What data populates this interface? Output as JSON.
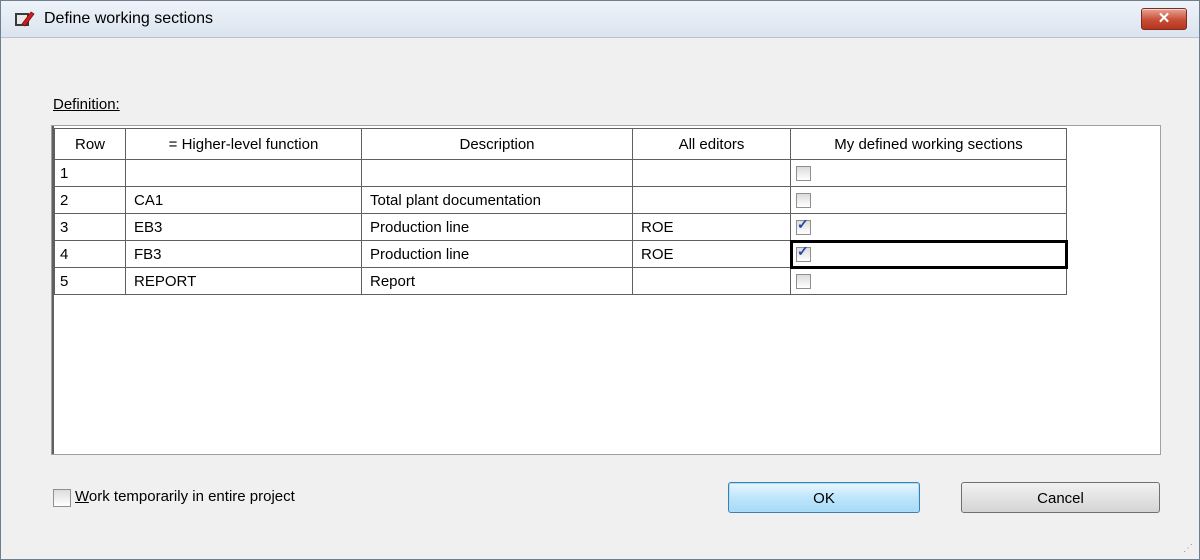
{
  "window": {
    "title": "Define working sections",
    "close_label": "✕"
  },
  "definition": {
    "label": "Definition:"
  },
  "table": {
    "columns": [
      "Row",
      "= Higher-level function",
      "Description",
      "All editors",
      "My defined working sections"
    ],
    "rows": [
      {
        "row": "1",
        "function": "",
        "description": "",
        "editors": "",
        "checked": false
      },
      {
        "row": "2",
        "function": "CA1",
        "description": "Total plant documentation",
        "editors": "",
        "checked": false
      },
      {
        "row": "3",
        "function": "EB3",
        "description": "Production line",
        "editors": "ROE",
        "checked": true
      },
      {
        "row": "4",
        "function": "FB3",
        "description": "Production line",
        "editors": "ROE",
        "checked": true
      },
      {
        "row": "5",
        "function": "REPORT",
        "description": "Report",
        "editors": "",
        "checked": false
      }
    ]
  },
  "footer": {
    "work_temp_label": "Work temporarily in entire project",
    "work_temp_checked": false,
    "ok_label": "OK",
    "cancel_label": "Cancel"
  },
  "colors": {
    "titlebar": "#dbe4ef",
    "close_button": "#c74d35",
    "ok_button_border": "#3c7fb1",
    "check_mark": "#2149a5"
  },
  "icons": [
    "app-icon",
    "close-icon",
    "check-icon",
    "resize-grip-icon"
  ]
}
